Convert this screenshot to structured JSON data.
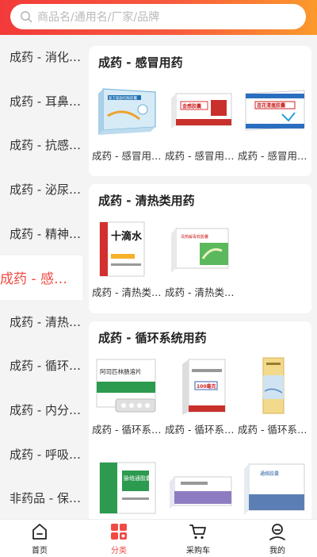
{
  "search": {
    "placeholder": "商品名/通用名/厂家/品牌"
  },
  "sidebar": {
    "items": [
      {
        "label": "成药 - 消化…"
      },
      {
        "label": "成药 - 耳鼻…"
      },
      {
        "label": "成药 - 抗感…"
      },
      {
        "label": "成药 - 泌尿…"
      },
      {
        "label": "成药 - 精神…"
      },
      {
        "label": "成药 - 感…",
        "active": true
      },
      {
        "label": "成药 - 清热…"
      },
      {
        "label": "成药 - 循环…"
      },
      {
        "label": "成药 - 内分…"
      },
      {
        "label": "成药 - 呼吸…"
      },
      {
        "label": "非药品 - 保…"
      }
    ]
  },
  "sections": [
    {
      "title": "成药 - 感冒用药",
      "products": [
        {
          "label": "成药 - 感冒用…",
          "box_text": "复方氨酚烷胺胶囊"
        },
        {
          "label": "成药 - 感冒用…",
          "box_text": "金感胶囊"
        },
        {
          "label": "成药 - 感冒用…",
          "box_text": "连花清瘟胶囊"
        }
      ]
    },
    {
      "title": "成药 - 清热类用药",
      "products": [
        {
          "label": "成药 - 清热类…",
          "box_text": "十滴水"
        },
        {
          "label": "成药 - 清热类…",
          "box_text": "清热解毒软胶囊"
        }
      ]
    },
    {
      "title": "成药 - 循环系统用药",
      "products": [
        {
          "label": "成药 - 循环系…",
          "box_text": "阿司匹林肠溶片"
        },
        {
          "label": "成药 - 循环系…",
          "box_text": "100毫克"
        },
        {
          "label": "成药 - 循环系…",
          "box_text": ""
        },
        {
          "label": "",
          "box_text": "脉络通胶囊"
        },
        {
          "label": "",
          "box_text": ""
        },
        {
          "label": "",
          "box_text": "通络胶囊"
        }
      ]
    }
  ],
  "tabbar": {
    "items": [
      {
        "label": "首页"
      },
      {
        "label": "分类",
        "active": true
      },
      {
        "label": "采购车"
      },
      {
        "label": "我的"
      }
    ]
  },
  "colors": {
    "accent": "#f04a43",
    "header_left": "#f23a3a",
    "header_right": "#fb9a2b"
  }
}
